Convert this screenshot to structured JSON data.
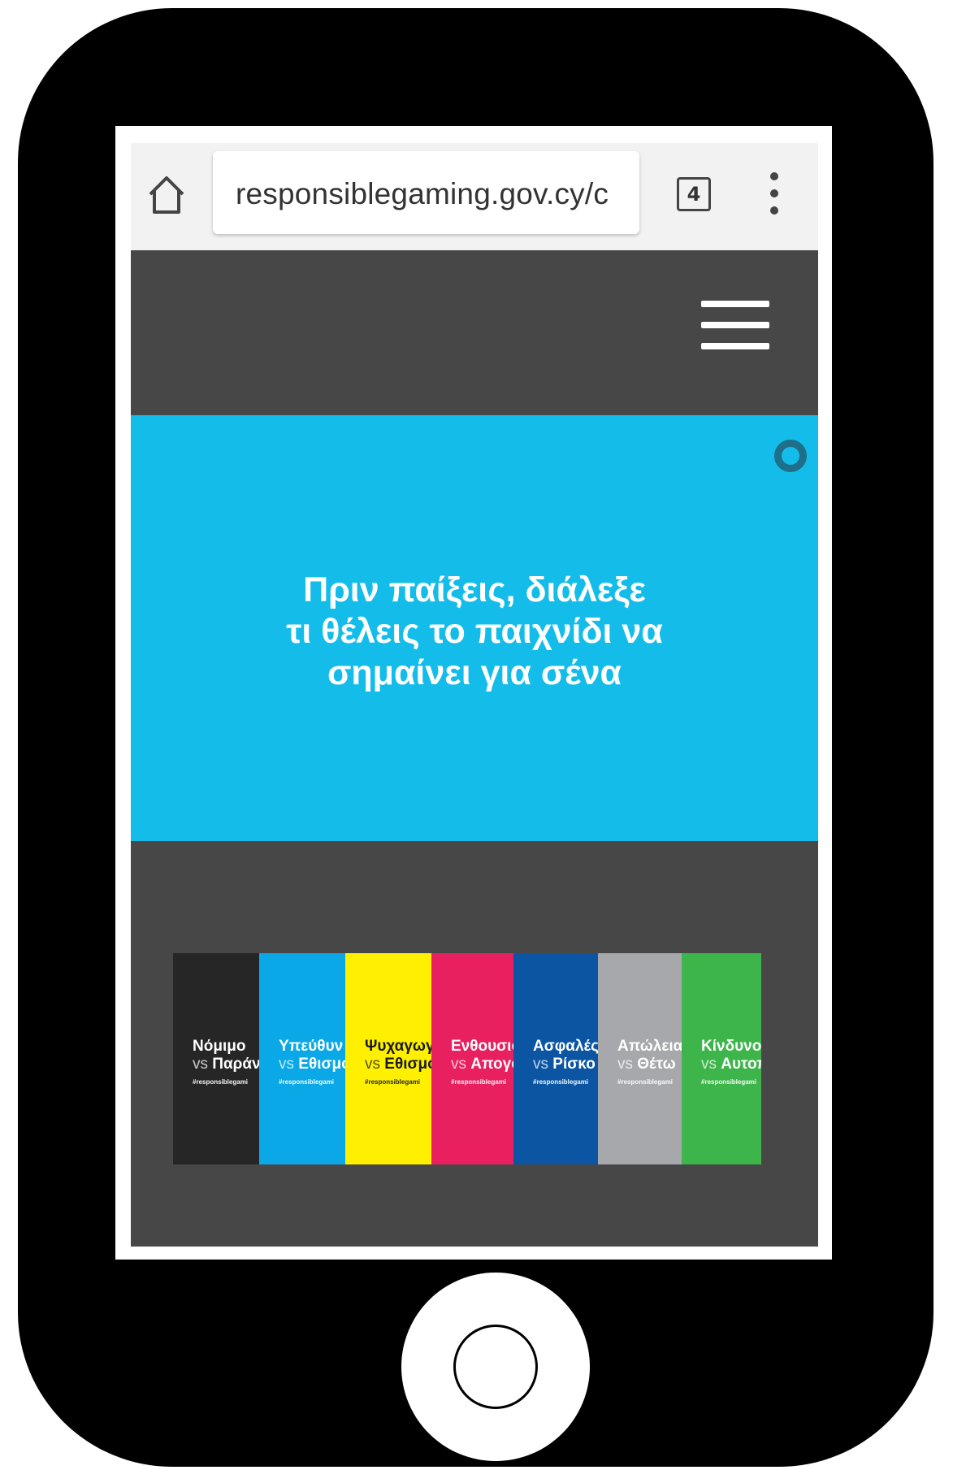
{
  "browser": {
    "url": "responsiblegaming.gov.cy/c",
    "tab_count": "4"
  },
  "hero": {
    "lines": [
      "Πριν παίξεις, διάλεξε",
      "τι θέλεις το παιχνίδι να",
      "σημαίνει για σένα"
    ]
  },
  "cards": [
    {
      "title": "Νόμιμο",
      "vs": "vs",
      "word": "Παράν",
      "tag": "#responsiblegami",
      "bg": "#262626",
      "fg": "#ffffff"
    },
    {
      "title": "Υπεύθυν",
      "vs": "vs",
      "word": "Εθισμό",
      "tag": "#responsiblegami",
      "bg": "#0aa8e6",
      "fg": "#ffffff"
    },
    {
      "title": "Ψυχαγωγ",
      "vs": "vs",
      "word": "Εθισμό",
      "tag": "#responsiblegami",
      "bg": "#fef000",
      "fg": "#1a1a1a"
    },
    {
      "title": "Ενθουσιο",
      "vs": "vs",
      "word": "Απογο",
      "tag": "#responsiblegami",
      "bg": "#e8205f",
      "fg": "#ffffff"
    },
    {
      "title": "Ασφαλές",
      "vs": "vs",
      "word": "Ρίσκο",
      "tag": "#responsiblegami",
      "bg": "#0b55a3",
      "fg": "#ffffff"
    },
    {
      "title": "Απώλεια",
      "vs": "vs",
      "word": "Θέτω",
      "tag": "#responsiblegami",
      "bg": "#a6a8ab",
      "fg": "#ffffff"
    },
    {
      "title": "Κίνδυνος",
      "vs": "vs",
      "word": "Αυτοπ",
      "tag": "#responsiblegami",
      "bg": "#3db54a",
      "fg": "#ffffff"
    }
  ],
  "colors": {
    "hero_bg": "#14bde9",
    "page_bg": "#474747",
    "browser_bar_bg": "#f2f2f2"
  },
  "icons": {
    "home": "home-icon",
    "tabs": "tabs-icon",
    "overflow_menu": "more-vert-icon",
    "site_menu": "hamburger-menu-icon"
  }
}
